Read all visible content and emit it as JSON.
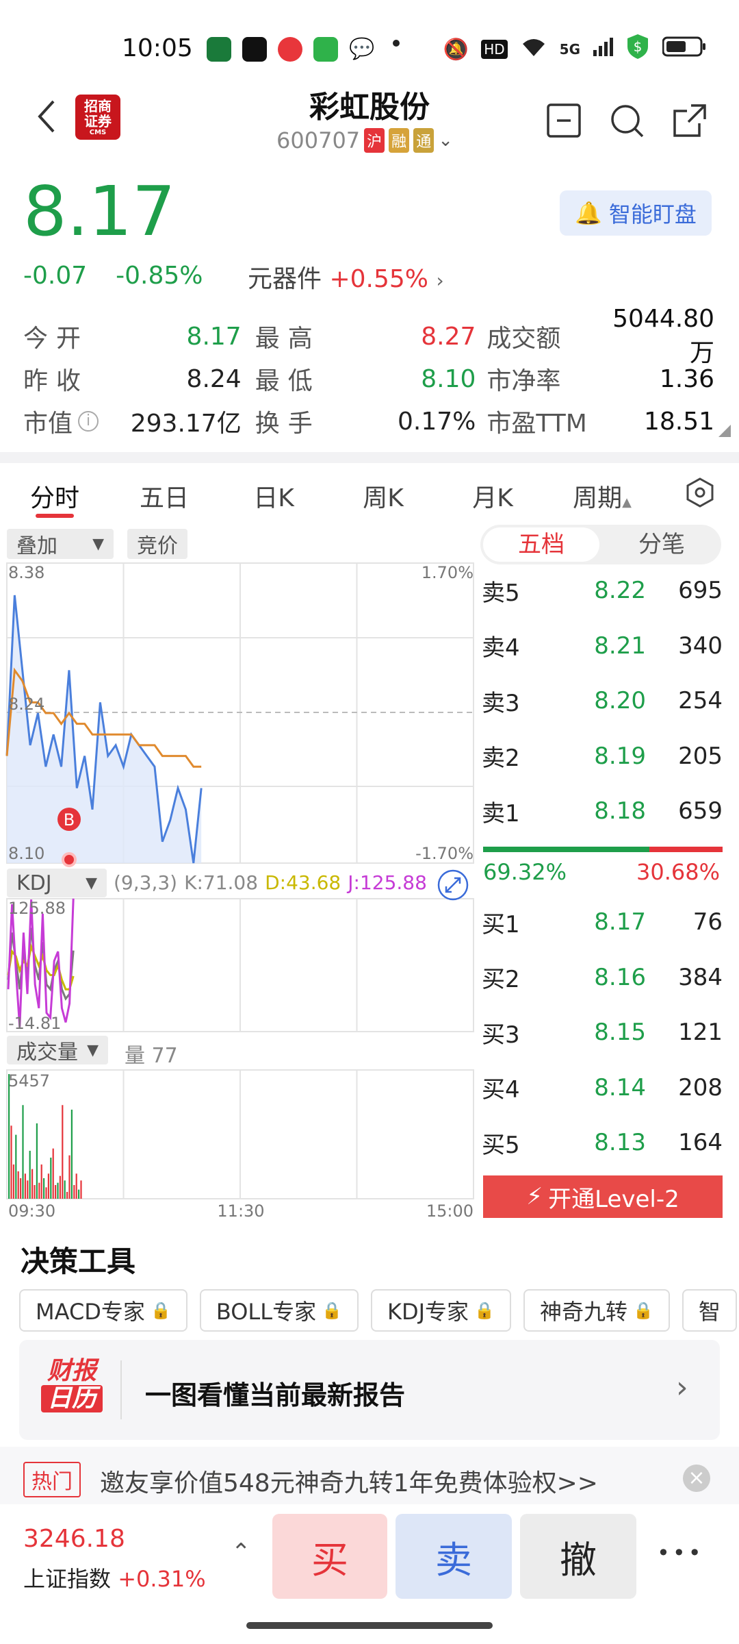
{
  "status_bar": {
    "time": "10:05",
    "network": "5G",
    "hd": "HD"
  },
  "header": {
    "back_icon": "chevron-left-icon",
    "broker_logo_lines": [
      "招商",
      "证券",
      "CMS"
    ],
    "stock_name": "彩虹股份",
    "stock_code": "600707",
    "tags": [
      "沪",
      "融",
      "通"
    ],
    "actions": [
      "minus-square-icon",
      "search-icon",
      "share-icon"
    ]
  },
  "quote": {
    "price": "8.17",
    "change": "-0.07",
    "change_pct": "-0.85%",
    "sector_name": "元器件",
    "sector_change": "+0.55%",
    "watch_button": "智能盯盘"
  },
  "stats": {
    "open_label": "今开",
    "open": "8.17",
    "high_label": "最高",
    "high": "8.27",
    "turnover_amt_label": "成交额",
    "turnover_amt": "5044.80万",
    "prev_close_label": "昨收",
    "prev_close": "8.24",
    "low_label": "最低",
    "low": "8.10",
    "pb_label": "市净率",
    "pb": "1.36",
    "mcap_label": "市值",
    "mcap": "293.17亿",
    "turnover_label": "换手",
    "turnover": "0.17%",
    "pe_label": "市盈TTM",
    "pe": "18.51"
  },
  "tabs": [
    "分时",
    "五日",
    "日K",
    "周K",
    "月K",
    "周期"
  ],
  "chart_controls": {
    "overlay": "叠加",
    "auction": "竞价"
  },
  "chart_data": [
    {
      "type": "line",
      "title": "分时",
      "y_left_labels": [
        "8.38",
        "8.24",
        "8.10"
      ],
      "y_right_labels": [
        "1.70%",
        "-1.70%"
      ],
      "x_labels": [
        "09:30",
        "11:30",
        "15:00"
      ],
      "ylim": [
        8.1,
        8.38
      ],
      "series": [
        {
          "name": "price",
          "color": "#4a7fdc",
          "values": [
            8.2,
            8.35,
            8.28,
            8.21,
            8.24,
            8.19,
            8.22,
            8.19,
            8.28,
            8.17,
            8.2,
            8.15,
            8.25,
            8.2,
            8.21,
            8.19,
            8.22,
            8.21,
            8.2,
            8.19,
            8.12,
            8.14,
            8.17,
            8.15,
            8.1,
            8.17
          ]
        },
        {
          "name": "avg",
          "color": "#e08a2e",
          "values": [
            8.2,
            8.28,
            8.27,
            8.25,
            8.25,
            8.24,
            8.24,
            8.23,
            8.24,
            8.23,
            8.23,
            8.22,
            8.22,
            8.22,
            8.22,
            8.22,
            8.22,
            8.21,
            8.21,
            8.21,
            8.2,
            8.2,
            8.2,
            8.2,
            8.19,
            8.19
          ]
        }
      ],
      "marker": "B"
    },
    {
      "type": "line",
      "title": "KDJ",
      "params": "(9,3,3)",
      "k_label": "K:",
      "k": "71.08",
      "d_label": "D:",
      "d": "43.68",
      "j_label": "J:",
      "j": "125.88",
      "y_labels": [
        "125.88",
        "-14.81"
      ],
      "ylim": [
        -14.81,
        125.88
      ],
      "series": [
        {
          "name": "K",
          "color": "#7a7a7a",
          "values": [
            40,
            90,
            60,
            30,
            70,
            45,
            95,
            55,
            40,
            80,
            35,
            30,
            50,
            60,
            30,
            20,
            25,
            71
          ]
        },
        {
          "name": "D",
          "color": "#c9b800",
          "values": [
            45,
            70,
            65,
            50,
            60,
            55,
            75,
            65,
            55,
            65,
            50,
            45,
            45,
            55,
            40,
            30,
            30,
            44
          ]
        },
        {
          "name": "J",
          "color": "#c63bd6",
          "values": [
            30,
            120,
            50,
            -10,
            90,
            25,
            125,
            35,
            10,
            110,
            5,
            0,
            60,
            70,
            10,
            -5,
            15,
            126
          ]
        }
      ]
    },
    {
      "type": "bar",
      "title": "成交量",
      "volume_label": "量",
      "volume": "77",
      "y_max_label": "5457",
      "ylim": [
        0,
        5457
      ],
      "values": [
        5457,
        3200,
        1500,
        2800,
        1200,
        900,
        4100,
        1100,
        800,
        2100,
        1300,
        600,
        3300,
        700,
        1500,
        900,
        500,
        1100,
        1800,
        2200,
        600,
        700,
        1000,
        4100,
        800,
        300,
        1900,
        3900,
        600,
        1100,
        400,
        800
      ],
      "colors": [
        "#e5343a",
        "#1e9e4a"
      ]
    }
  ],
  "order_book": {
    "tab_active": "五档",
    "tab_other": "分笔",
    "asks": [
      {
        "label": "卖5",
        "price": "8.22",
        "vol": "695"
      },
      {
        "label": "卖4",
        "price": "8.21",
        "vol": "340"
      },
      {
        "label": "卖3",
        "price": "8.20",
        "vol": "254"
      },
      {
        "label": "卖2",
        "price": "8.19",
        "vol": "205"
      },
      {
        "label": "卖1",
        "price": "8.18",
        "vol": "659"
      }
    ],
    "buy_ratio": "69.32%",
    "sell_ratio": "30.68%",
    "bids": [
      {
        "label": "买1",
        "price": "8.17",
        "vol": "76"
      },
      {
        "label": "买2",
        "price": "8.16",
        "vol": "384"
      },
      {
        "label": "买3",
        "price": "8.15",
        "vol": "121"
      },
      {
        "label": "买4",
        "price": "8.14",
        "vol": "208"
      },
      {
        "label": "买5",
        "price": "8.13",
        "vol": "164"
      }
    ],
    "level2_button": "开通Level-2"
  },
  "tools": {
    "title": "决策工具",
    "items": [
      "MACD专家",
      "BOLL专家",
      "KDJ专家",
      "神奇九转",
      "智"
    ],
    "banner_logo_lines": [
      "财报",
      "日历"
    ],
    "banner_text": "一图看懂当前最新报告"
  },
  "promo": {
    "tag": "热门",
    "text": "邀友享价值548元神奇九转1年免费体验权>>"
  },
  "bottom_bar": {
    "index_value": "3246.18",
    "index_name": "上证指数",
    "index_change": "+0.31%",
    "buy": "买",
    "sell": "卖",
    "cancel": "撤",
    "more": "•••"
  }
}
